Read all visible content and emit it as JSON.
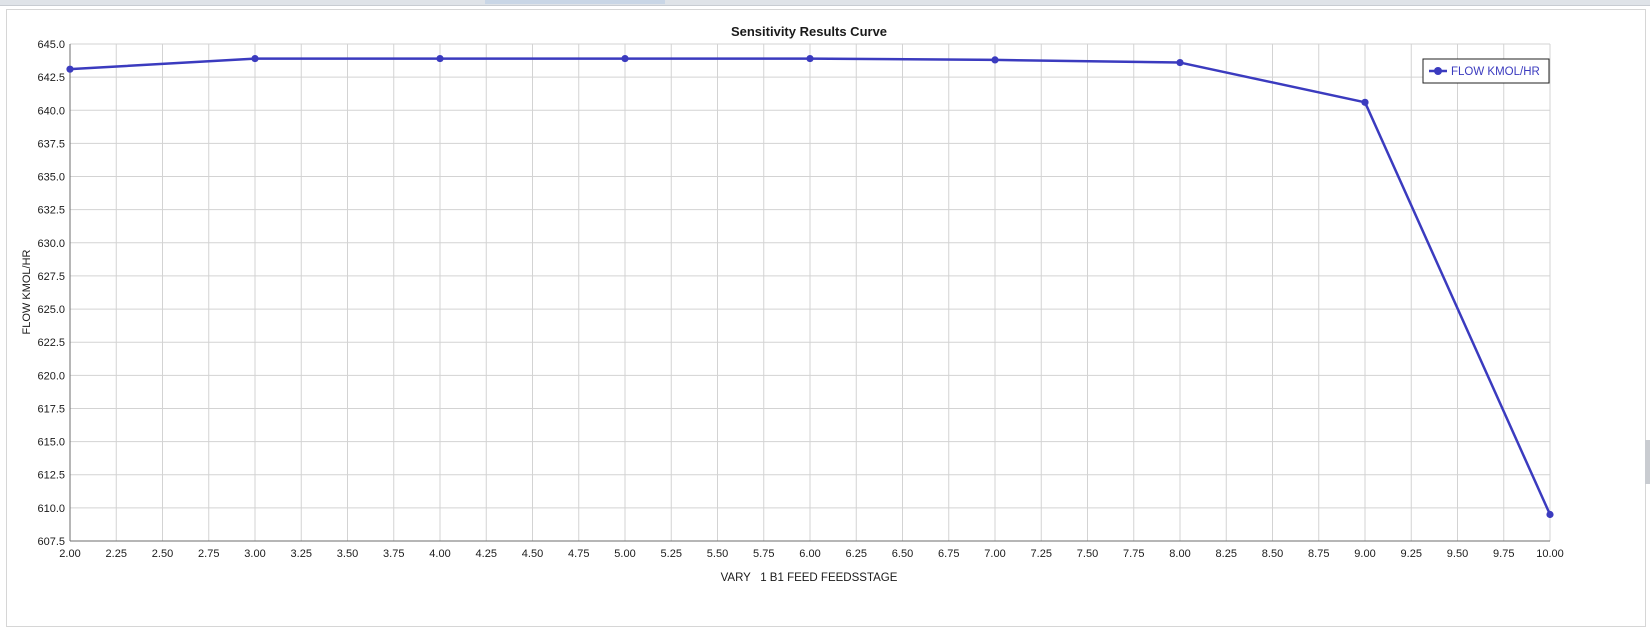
{
  "chart_data": {
    "type": "line",
    "title": "Sensitivity Results Curve",
    "xlabel": "VARY   1 B1 FEED FEEDSSTAGE",
    "ylabel": "FLOW KMOL/HR",
    "xlim": [
      2.0,
      10.0
    ],
    "ylim": [
      607.5,
      645.0
    ],
    "xticks": [
      2.0,
      2.25,
      2.5,
      2.75,
      3.0,
      3.25,
      3.5,
      3.75,
      4.0,
      4.25,
      4.5,
      4.75,
      5.0,
      5.25,
      5.5,
      5.75,
      6.0,
      6.25,
      6.5,
      6.75,
      7.0,
      7.25,
      7.5,
      7.75,
      8.0,
      8.25,
      8.5,
      8.75,
      9.0,
      9.25,
      9.5,
      9.75,
      10.0
    ],
    "xtick_labels": [
      "2.00",
      "2.25",
      "2.50",
      "2.75",
      "3.00",
      "3.25",
      "3.50",
      "3.75",
      "4.00",
      "4.25",
      "4.50",
      "4.75",
      "5.00",
      "5.25",
      "5.50",
      "5.75",
      "6.00",
      "6.25",
      "6.50",
      "6.75",
      "7.00",
      "7.25",
      "7.50",
      "7.75",
      "8.00",
      "8.25",
      "8.50",
      "8.75",
      "9.00",
      "9.25",
      "9.50",
      "9.75",
      "10.00"
    ],
    "yticks": [
      607.5,
      610.0,
      612.5,
      615.0,
      617.5,
      620.0,
      622.5,
      625.0,
      627.5,
      630.0,
      632.5,
      635.0,
      637.5,
      640.0,
      642.5,
      645.0
    ],
    "ytick_labels": [
      "607.5",
      "610.0",
      "612.5",
      "615.0",
      "617.5",
      "620.0",
      "622.5",
      "625.0",
      "627.5",
      "630.0",
      "632.5",
      "635.0",
      "637.5",
      "640.0",
      "642.5",
      "645.0"
    ],
    "grid": true,
    "legend_position": "top-right",
    "series": [
      {
        "name": "FLOW KMOL/HR",
        "color": "#3b3bbf",
        "x": [
          2,
          3,
          4,
          5,
          6,
          7,
          8,
          9,
          10
        ],
        "y": [
          643.1,
          643.9,
          643.9,
          643.9,
          643.9,
          643.8,
          643.6,
          640.6,
          609.5
        ]
      }
    ]
  },
  "colors": {
    "grid": "#d3d3d3",
    "axis": "#6e6e6e",
    "text": "#1a1a1a",
    "series": "#3b3bbf"
  }
}
